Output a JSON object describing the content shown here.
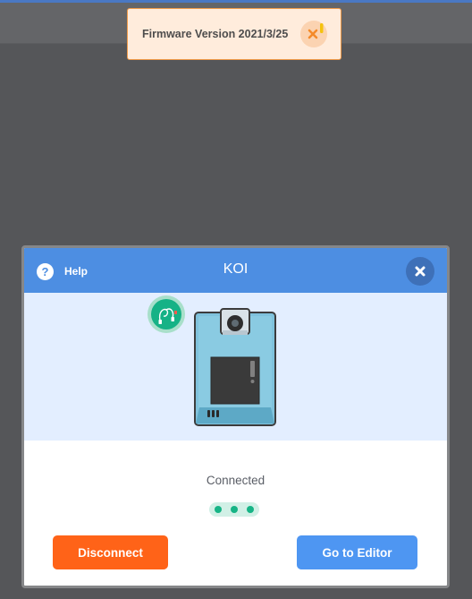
{
  "toast": {
    "message": "Firmware Version 2021/3/25",
    "close_icon": "close-icon",
    "close_color": "#f48a2a",
    "indicator_color": "#f4c20d"
  },
  "modal": {
    "title": "KOI",
    "help_label": "Help",
    "help_icon_glyph": "?",
    "close_icon": "close-icon",
    "header_color": "#4d8ee2",
    "device_icon": "koi-device-icon",
    "cable_icon": "cable-icon",
    "status": "Connected",
    "progress_dots": 3,
    "disconnect_label": "Disconnect",
    "editor_label": "Go to Editor",
    "disconnect_color": "#ff6318",
    "editor_color": "#4e96f2",
    "connected_color": "#17b486"
  }
}
